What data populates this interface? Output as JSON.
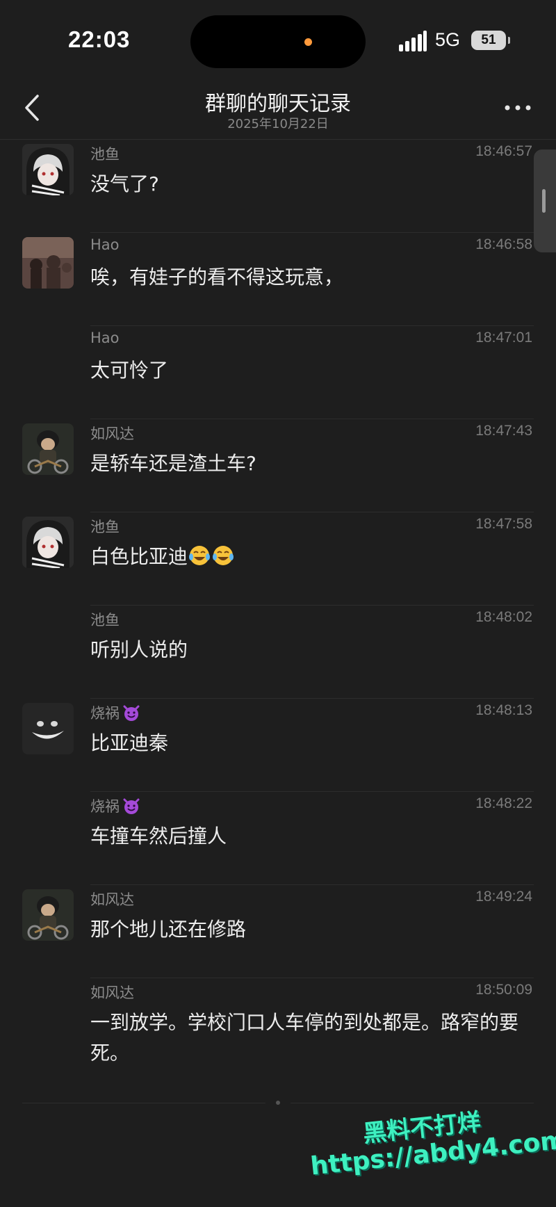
{
  "status_bar": {
    "time": "22:03",
    "network": "5G",
    "battery": "51"
  },
  "nav": {
    "title": "群聊的聊天记录",
    "subtitle": "2025年10月22日"
  },
  "messages": [
    {
      "sender": "池鱼",
      "time": "18:46:57",
      "text": "没气了?"
    },
    {
      "sender": "Hao",
      "time": "18:46:58",
      "text": "唉，有娃子的看不得这玩意，"
    },
    {
      "sender": "Hao",
      "time": "18:47:01",
      "text": "太可怜了"
    },
    {
      "sender": "如风达",
      "time": "18:47:43",
      "text": "是轿车还是渣土车?"
    },
    {
      "sender": "池鱼",
      "time": "18:47:58",
      "text": "白色比亚迪"
    },
    {
      "sender": "池鱼",
      "time": "18:48:02",
      "text": "听别人说的"
    },
    {
      "sender": "烧祸",
      "time": "18:48:13",
      "text": "比亚迪秦"
    },
    {
      "sender": "烧祸",
      "time": "18:48:22",
      "text": "车撞车然后撞人"
    },
    {
      "sender": "如风达",
      "time": "18:49:24",
      "text": "那个地儿还在修路"
    },
    {
      "sender": "如风达",
      "time": "18:50:09",
      "text": "一到放学。学校门口人车停的到处都是。路窄的要死。"
    }
  ],
  "watermark": {
    "line1": "黑料不打烊",
    "line2": "https://abdy4.com"
  },
  "colors": {
    "background": "#1e1e1e",
    "text": "#ececec",
    "muted": "#8b8b8b",
    "watermark": "#3ef0c0"
  }
}
